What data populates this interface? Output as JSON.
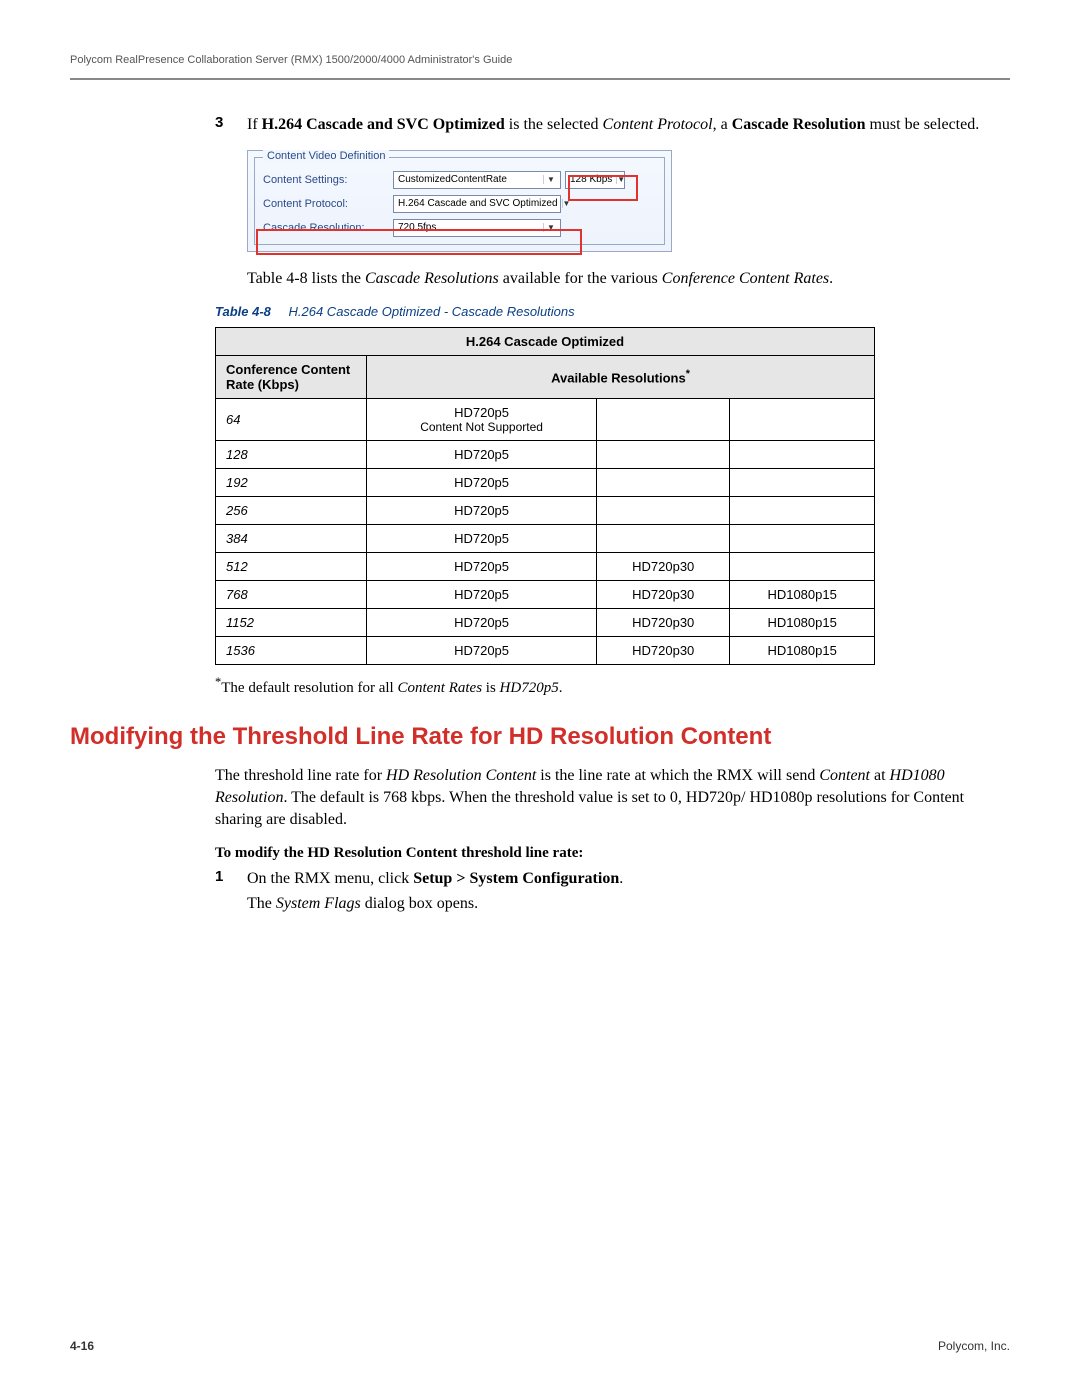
{
  "running_head": "Polycom RealPresence Collaboration Server (RMX) 1500/2000/4000 Administrator's Guide",
  "step3": {
    "num": "3",
    "prefix": "If ",
    "bold1": "H.264 Cascade and SVC Optimized",
    "mid1": " is the selected ",
    "ital1": "Content Protocol",
    "mid2": ", a ",
    "bold2": "Cascade Resolution",
    "suffix": " must be selected."
  },
  "ui": {
    "legend": "Content Video Definition",
    "rows": {
      "settings_label": "Content Settings:",
      "settings_value": "CustomizedContentRate",
      "rate_value": "128 Kbps",
      "protocol_label": "Content Protocol:",
      "protocol_value": "H.264 Cascade and SVC Optimized",
      "cascade_label": "Cascade Resolution:",
      "cascade_value": "720 5fps"
    }
  },
  "caption_sentence": {
    "pre": "Table 4-8 lists the ",
    "i1": "Cascade Resolutions",
    "mid": " available for the various ",
    "i2": "Conference Content Rates",
    "post": "."
  },
  "table_caption": {
    "label": "Table 4-8",
    "title": "H.264 Cascade Optimized - Cascade Resolutions"
  },
  "table": {
    "top_header": "H.264 Cascade Optimized",
    "col_rate": "Conference Content Rate (Kbps)",
    "col_avail": "Available Resolutions",
    "avail_sup": "*",
    "rows": [
      {
        "rate": "64",
        "c1a": "HD720p5",
        "c1b": "Content Not Supported",
        "c2": "",
        "c3": ""
      },
      {
        "rate": "128",
        "c1a": "HD720p5",
        "c1b": "",
        "c2": "",
        "c3": ""
      },
      {
        "rate": "192",
        "c1a": "HD720p5",
        "c1b": "",
        "c2": "",
        "c3": ""
      },
      {
        "rate": "256",
        "c1a": "HD720p5",
        "c1b": "",
        "c2": "",
        "c3": ""
      },
      {
        "rate": "384",
        "c1a": "HD720p5",
        "c1b": "",
        "c2": "",
        "c3": ""
      },
      {
        "rate": "512",
        "c1a": "HD720p5",
        "c1b": "",
        "c2": "HD720p30",
        "c3": ""
      },
      {
        "rate": "768",
        "c1a": "HD720p5",
        "c1b": "",
        "c2": "HD720p30",
        "c3": "HD1080p15"
      },
      {
        "rate": "1152",
        "c1a": "HD720p5",
        "c1b": "",
        "c2": "HD720p30",
        "c3": "HD1080p15"
      },
      {
        "rate": "1536",
        "c1a": "HD720p5",
        "c1b": "",
        "c2": "HD720p30",
        "c3": "HD1080p15"
      }
    ]
  },
  "footnote": {
    "star": "*",
    "pre": "The default resolution for all ",
    "i1": "Content Rates",
    "mid": " is ",
    "i2": "HD720p5",
    "post": "."
  },
  "section_heading": "Modifying the Threshold Line Rate for HD Resolution Content",
  "p1": {
    "a": "The threshold line rate for ",
    "i1": "HD Resolution Content",
    "b": " is the line rate at which the RMX will send ",
    "i2": "Content",
    "c": " at ",
    "i3": "HD1080 Resolution",
    "d": ". The default is 768 kbps. When the threshold value is set to 0, HD720p/ HD1080p resolutions for Content sharing are disabled."
  },
  "proc_head": "To modify the HD Resolution Content threshold line rate:",
  "step1": {
    "num": "1",
    "a": "On the RMX menu, click ",
    "b1": "Setup > System Configuration",
    "b": ".",
    "line2a": "The ",
    "line2i": "System Flags",
    "line2b": " dialog box opens."
  },
  "footer": {
    "page": "4-16",
    "owner": "Polycom, Inc."
  }
}
